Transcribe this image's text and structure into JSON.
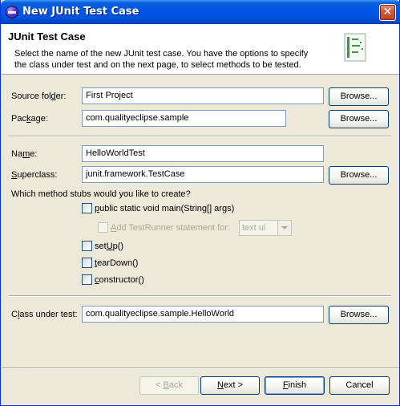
{
  "window": {
    "title": "New JUnit Test Case",
    "close_symbol": "✕"
  },
  "header": {
    "title": "JUnit Test Case",
    "desc_line1": "Select the name of the new JUnit test case. You have the options to specify",
    "desc_line2": "the class under test and on the next page, to select methods to be tested.",
    "icon": "junit-wizard-icon"
  },
  "form": {
    "source_folder": {
      "label_pre": "Source fol",
      "label_mn": "d",
      "label_post": "er:",
      "value": "First Project",
      "button": "Browse..."
    },
    "package": {
      "label_pre": "Pac",
      "label_mn": "k",
      "label_post": "age:",
      "value": "com.qualityeclipse.sample",
      "button": "Browse..."
    },
    "name": {
      "label_pre": "Na",
      "label_mn": "m",
      "label_post": "e:",
      "value": "HelloWorldTest"
    },
    "superclass": {
      "label_pre": "",
      "label_mn": "S",
      "label_post": "uperclass:",
      "value": "junit.framework.TestCase",
      "button": "Browse..."
    },
    "stubs_question": "Which method stubs would you like to create?",
    "stubs": {
      "main": {
        "label_mn": "p",
        "label_post": "ublic static void main(String[] args)",
        "checked": false
      },
      "testrunner": {
        "label_pre": "",
        "label_mn": "A",
        "label_post": "dd TestRunner statement for:",
        "checked": false,
        "disabled": true
      },
      "testrunner_combo": "text ui",
      "setup": {
        "label_pre": "set",
        "label_mn": "U",
        "label_post": "p()",
        "checked": false
      },
      "teardown": {
        "label_pre": "",
        "label_mn": "t",
        "label_post": "earDown()",
        "checked": false
      },
      "constructor": {
        "label_pre": "",
        "label_mn": "c",
        "label_post": "onstructor()",
        "checked": false
      }
    },
    "class_under_test": {
      "label_pre": "C",
      "label_mn": "l",
      "label_post": "ass under test:",
      "value": "com.qualityeclipse.sample.HelloWorld",
      "button": "Browse..."
    }
  },
  "footer": {
    "back": {
      "pre": "< ",
      "mn": "B",
      "post": "ack"
    },
    "next": {
      "pre": "",
      "mn": "N",
      "post": "ext >"
    },
    "finish": {
      "pre": "",
      "mn": "F",
      "post": "inish"
    },
    "cancel": "Cancel"
  }
}
